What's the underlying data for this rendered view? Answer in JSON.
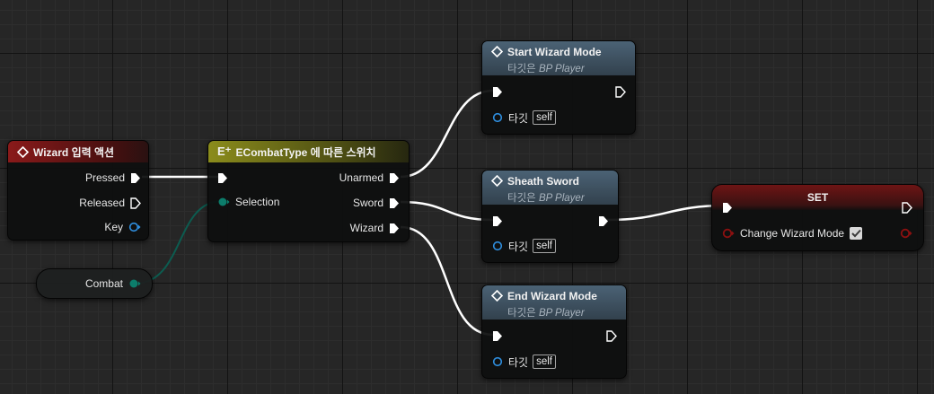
{
  "nodes": {
    "wizard_input": {
      "title": "Wizard 입력 액션",
      "header_color": "#8a1a1a",
      "outputs": [
        "Pressed",
        "Released",
        "Key"
      ]
    },
    "combat_var": {
      "label": "Combat"
    },
    "switch": {
      "title": "ECombatType 에 따른 스위치",
      "header_color": "#8b8c1c",
      "input_label": "Selection",
      "outputs": [
        "Unarmed",
        "Sword",
        "Wizard"
      ]
    },
    "start_wizard": {
      "title": "Start Wizard Mode",
      "subtitle_prefix": "타깃은",
      "subtitle_target": "BP Player",
      "target_label": "타깃",
      "self_label": "self"
    },
    "sheath_sword": {
      "title": "Sheath Sword",
      "subtitle_prefix": "타깃은",
      "subtitle_target": "BP Player",
      "target_label": "타깃",
      "self_label": "self"
    },
    "end_wizard": {
      "title": "End Wizard Mode",
      "subtitle_prefix": "타깃은",
      "subtitle_target": "BP Player",
      "target_label": "타깃",
      "self_label": "self"
    },
    "set_node": {
      "title": "SET",
      "header_color": "#6e1414",
      "variable_label": "Change Wizard Mode",
      "checked": true
    }
  },
  "colors": {
    "exec_wire": "#ffffff",
    "enum_wire": "#0c5c50",
    "object_pin": "#2f8fe0",
    "bool_pin": "#8c1010",
    "function_header": "#3e5366"
  }
}
